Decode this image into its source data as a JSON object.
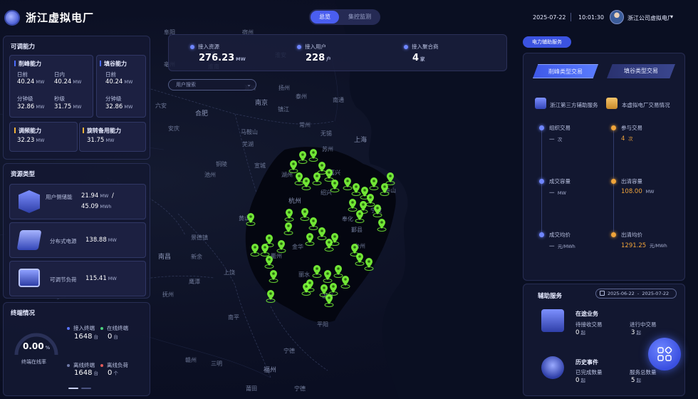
{
  "header": {
    "title": "浙江虚拟电厂",
    "tabs": [
      {
        "label": "总览",
        "active": true
      },
      {
        "label": "集控监测",
        "active": false
      }
    ],
    "date": "2025-07-22",
    "time": "10:01:30",
    "org": "浙江公司虚拟电厂",
    "org_chevron": "▾"
  },
  "map": {
    "search_placeholder": "用户搜索",
    "search_chevron": "⌄",
    "cities": [
      "南京",
      "镇江",
      "苏州",
      "无锡",
      "常州",
      "扬州",
      "上海",
      "杭州",
      "合肥",
      "芜湖",
      "马鞍山",
      "铜陵",
      "安庆",
      "池州",
      "黄山",
      "景德镇",
      "上饶",
      "南昌",
      "抚州",
      "鹰潭",
      "南平",
      "宁德",
      "福州",
      "衢州",
      "金华",
      "丽水",
      "温州",
      "台州",
      "宁波",
      "绍兴",
      "嘉兴",
      "湖州",
      "宣城",
      "泰州",
      "南通",
      "淮安",
      "六安",
      "滁州",
      "宁德",
      "三明",
      "莆田",
      "鄞县",
      "奉化",
      "新余",
      "赣州",
      "平阳",
      "舟山",
      "蚌埠",
      "阜阳",
      "淮南",
      "宿州",
      "亳州"
    ]
  },
  "top_stats": [
    {
      "label": "接入资源",
      "value": "276.23",
      "unit": "MW"
    },
    {
      "label": "接入用户",
      "value": "228",
      "unit": "户"
    },
    {
      "label": "接入聚合商",
      "value": "4",
      "unit": "家"
    }
  ],
  "adjustable": {
    "title": "可调能力",
    "peak": {
      "title": "削峰能力",
      "items": [
        {
          "label": "日前",
          "value": "40.24",
          "unit": "MW"
        },
        {
          "label": "日内",
          "value": "40.24",
          "unit": "MW"
        },
        {
          "label": "分钟级",
          "value": "32.86",
          "unit": "MW"
        },
        {
          "label": "秒级",
          "value": "31.75",
          "unit": "MW"
        }
      ]
    },
    "valley": {
      "title": "填谷能力",
      "items": [
        {
          "label": "日前",
          "value": "40.24",
          "unit": "MW"
        },
        {
          "label": "分钟级",
          "value": "32.86",
          "unit": "MW"
        }
      ]
    },
    "fm": {
      "title": "调频能力",
      "value": "32.23",
      "unit": "MW"
    },
    "spin": {
      "title": "旋转备用能力",
      "value": "31.75",
      "unit": "MW"
    }
  },
  "resources": {
    "title": "资源类型",
    "items": [
      {
        "label": "用户侧储能",
        "value": "21.94",
        "unit": "MW",
        "sep": "/",
        "value2": "45.09",
        "unit2": "MWh",
        "icon": "battery-storage-icon"
      },
      {
        "label": "分布式电源",
        "value": "138.88",
        "unit": "MW",
        "icon": "solar-panel-icon"
      },
      {
        "label": "可调节负荷",
        "value": "115.41",
        "unit": "MW",
        "icon": "monitor-load-icon"
      }
    ]
  },
  "terminals": {
    "title": "终端情况",
    "online_rate": 0,
    "online_rate_text": "0.00",
    "online_rate_unit": "%",
    "online_rate_label": "终端在线率",
    "items": [
      {
        "label": "接入终端",
        "value": "1648",
        "unit": "台"
      },
      {
        "label": "在线终端",
        "value": "0",
        "unit": "台"
      },
      {
        "label": "离线终端",
        "value": "1648",
        "unit": "台"
      },
      {
        "label": "离线负荷",
        "value": "0",
        "unit": "个"
      }
    ]
  },
  "ancillary": {
    "tag": "电力辅助服务",
    "tabs": [
      {
        "label": "削峰类型交易",
        "active": true
      },
      {
        "label": "填谷类型交易",
        "active": false
      }
    ],
    "sources": [
      {
        "label": "浙江第三方辅助服务",
        "icon": "folder-icon"
      },
      {
        "label": "本虚拟电厂交易情况",
        "icon": "briefcase-icon"
      }
    ],
    "left": [
      {
        "label": "组织交易",
        "value": "一",
        "unit": "次"
      },
      {
        "label": "成交容量",
        "value": "一",
        "unit": "MW"
      },
      {
        "label": "成交均价",
        "value": "一",
        "unit": "元/MWh"
      }
    ],
    "right": [
      {
        "label": "参与交易",
        "value": "4",
        "unit": "次"
      },
      {
        "label": "出清容量",
        "value": "108.00",
        "unit": "MW"
      },
      {
        "label": "出清均价",
        "value": "1291.25",
        "unit": "元/MWh"
      }
    ]
  },
  "aux_service": {
    "title": "辅助服务",
    "date_from": "2025-06-22",
    "date_sep": "-",
    "date_to": "2025-07-22",
    "in_progress": {
      "title": "在途业务",
      "items": [
        {
          "label": "待接收交易",
          "value": "0",
          "unit": "起"
        },
        {
          "label": "进行中交易",
          "value": "3",
          "unit": "起"
        }
      ]
    },
    "history": {
      "title": "历史事件",
      "items": [
        {
          "label": "已完成数量",
          "value": "0",
          "unit": "起"
        },
        {
          "label": "服务总数量",
          "value": "5",
          "unit": "起"
        }
      ]
    }
  },
  "colors": {
    "accent": "#4a5ef0",
    "orange": "#f0a43a",
    "pin": "#7dff3a"
  }
}
